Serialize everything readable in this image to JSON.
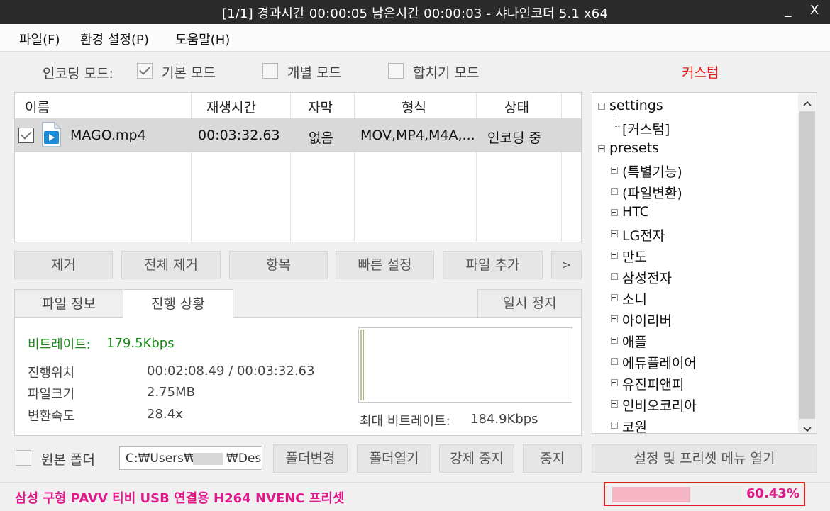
{
  "window": {
    "title": "[1/1] 경과시간 00:00:05  남은시간 00:00:03 - 샤나인코더 5.1 x64",
    "minimize_glyph": "_",
    "close_glyph": "X"
  },
  "menu": [
    "파일(F)",
    "환경 설정(P)",
    "도움말(H)"
  ],
  "mode": {
    "label": "인코딩 모드:",
    "options": [
      {
        "label": "기본 모드",
        "checked": true
      },
      {
        "label": "개별 모드",
        "checked": false
      },
      {
        "label": "합치기 모드",
        "checked": false
      }
    ],
    "custom_label": "커스텀",
    "custom_color": "#e8190e"
  },
  "file_list": {
    "columns": [
      "이름",
      "재생시간",
      "자막",
      "형식",
      "상태"
    ],
    "rows": [
      {
        "checked": true,
        "icon": "video-file-icon",
        "name": "MAGO.mp4",
        "duration": "00:03:32.63",
        "subtitle": "없음",
        "format": "MOV,MP4,M4A,...",
        "status": "인코딩 중"
      }
    ]
  },
  "list_buttons": [
    "제거",
    "전체 제거",
    "항목",
    "빠른 설정",
    "파일 추가",
    ">"
  ],
  "tabs": {
    "items": [
      "파일 정보",
      "진행 상황"
    ],
    "active": "진행 상황",
    "pause_button": "일시 정지"
  },
  "progress": {
    "bitrate_label": "비트레이트:",
    "bitrate_value": "179.5Kbps",
    "bitrate_color": "#1a8a1a",
    "position_label": "진행위치",
    "position_value": "00:02:08.49 / 00:03:32.63",
    "filesize_label": "파일크기",
    "filesize_value": "2.75MB",
    "speed_label": "변환속도",
    "speed_value": "28.4x",
    "max_bitrate_label": "최대 비트레이트:",
    "max_bitrate_value": "184.9Kbps"
  },
  "tree": {
    "nodes": [
      {
        "label": "settings",
        "level": 0,
        "expander": "minus"
      },
      {
        "label": "[커스텀]",
        "level": 1,
        "expander": "none"
      },
      {
        "label": "presets",
        "level": 0,
        "expander": "minus"
      },
      {
        "label": "(특별기능)",
        "level": 1,
        "expander": "plus"
      },
      {
        "label": "(파일변환)",
        "level": 1,
        "expander": "plus"
      },
      {
        "label": "HTC",
        "level": 1,
        "expander": "plus"
      },
      {
        "label": "LG전자",
        "level": 1,
        "expander": "plus"
      },
      {
        "label": "만도",
        "level": 1,
        "expander": "plus"
      },
      {
        "label": "삼성전자",
        "level": 1,
        "expander": "plus"
      },
      {
        "label": "소니",
        "level": 1,
        "expander": "plus"
      },
      {
        "label": "아이리버",
        "level": 1,
        "expander": "plus"
      },
      {
        "label": "애플",
        "level": 1,
        "expander": "plus"
      },
      {
        "label": "에듀플레이어",
        "level": 1,
        "expander": "plus"
      },
      {
        "label": "유진피앤피",
        "level": 1,
        "expander": "plus"
      },
      {
        "label": "인비오코리아",
        "level": 1,
        "expander": "plus"
      },
      {
        "label": "코원",
        "level": 1,
        "expander": "plus"
      }
    ]
  },
  "output": {
    "source_folder_label": "원본 폴더",
    "source_folder_checked": false,
    "path_value": "C:₩Users₩        ₩Des",
    "buttons": [
      "폴더변경",
      "폴더열기",
      "강제 중지",
      "중지"
    ],
    "preset_menu_button": "설정 및 프리셋 메뉴 열기"
  },
  "status": {
    "preset_text": "삼성 구형 PAVV 티비 USB 연결용 H264 NVENC 프리셋",
    "preset_color": "#e0198a",
    "percent_text": "60.43%",
    "percent": 60.43,
    "highlight_color": "#e02020"
  }
}
